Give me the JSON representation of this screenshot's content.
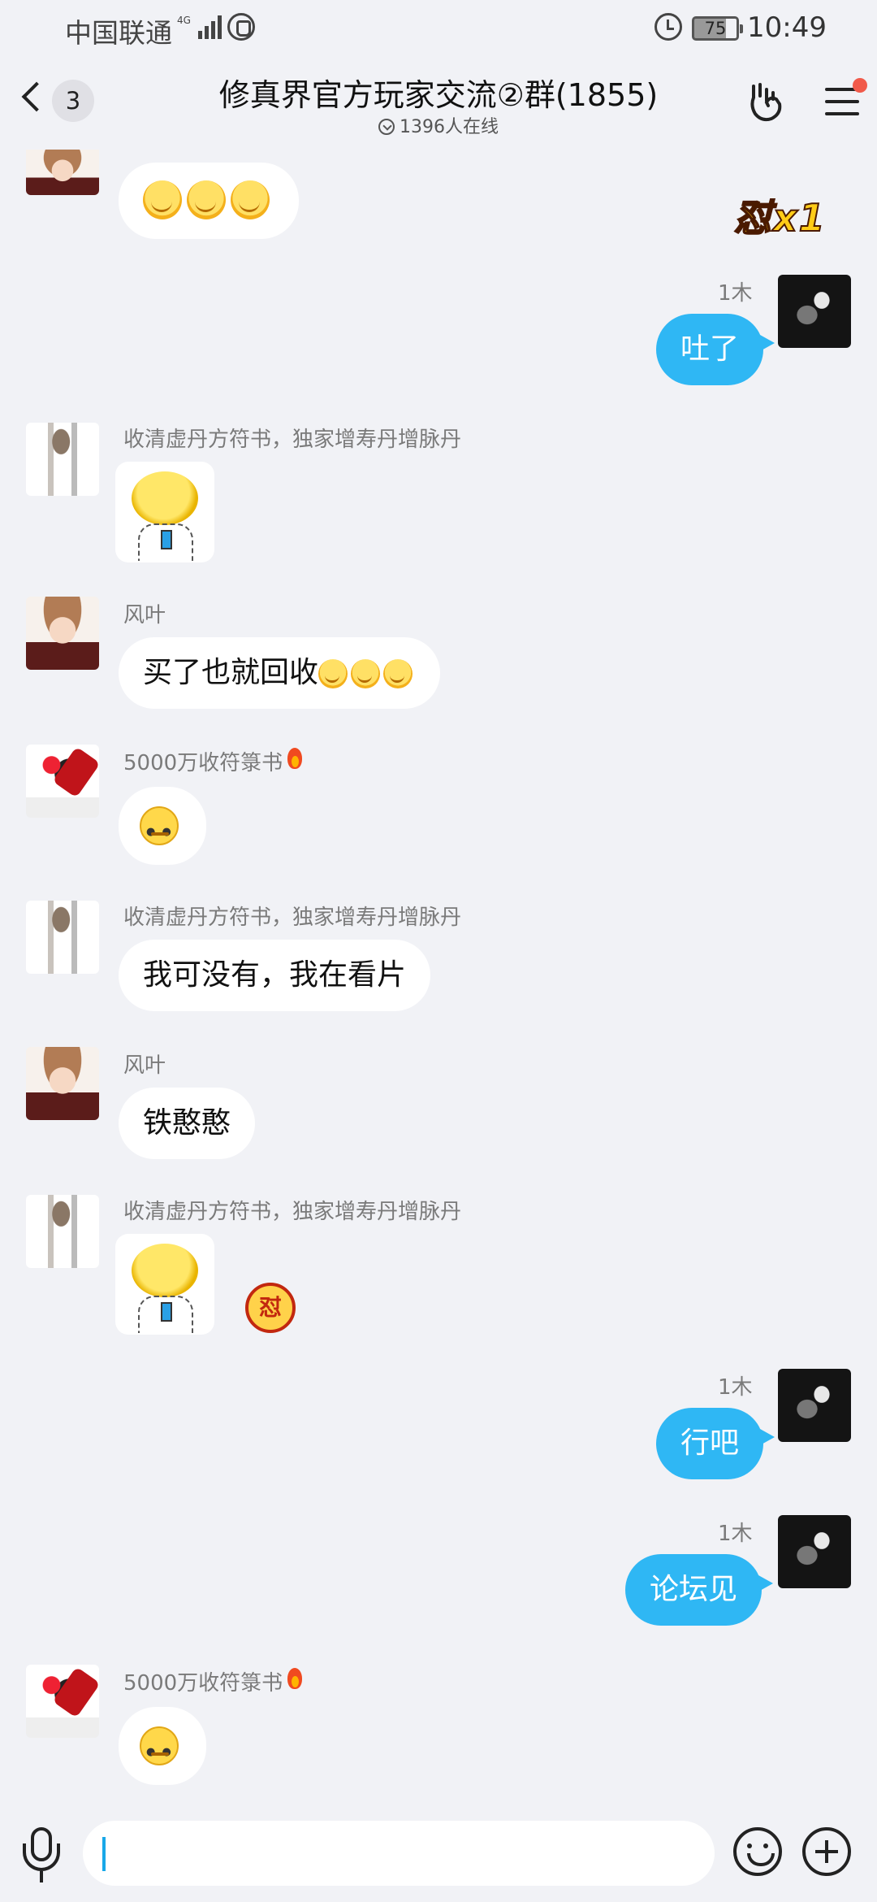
{
  "status_bar": {
    "carrier": "中国联通",
    "network": "4G",
    "battery": "75",
    "time": "10:49"
  },
  "header": {
    "back_count": "3",
    "title": "修真界官方玩家交流②群(1855)",
    "online": "1396人在线"
  },
  "badge_text": "怼x1",
  "duo_badge_text": "怼",
  "messages": [
    {
      "sender": "",
      "type": "emoji",
      "emojis": 3
    },
    {
      "sender": "1木",
      "type": "text",
      "text": "吐了",
      "me": true
    },
    {
      "sender": "收清虚丹方符书，独家增寿丹增脉丹",
      "type": "sticker"
    },
    {
      "sender": "风叶",
      "type": "text",
      "text": "买了也就回收"
    },
    {
      "sender": "5000万收符箓书",
      "type": "emoji"
    },
    {
      "sender": "收清虚丹方符书，独家增寿丹增脉丹",
      "type": "text",
      "text": "我可没有，我在看片"
    },
    {
      "sender": "风叶",
      "type": "text",
      "text": "铁憨憨"
    },
    {
      "sender": "收清虚丹方符书，独家增寿丹增脉丹",
      "type": "sticker"
    },
    {
      "sender": "1木",
      "type": "text",
      "text": "行吧",
      "me": true
    },
    {
      "sender": "1木",
      "type": "text",
      "text": "论坛见",
      "me": true
    },
    {
      "sender": "5000万收符箓书",
      "type": "emoji"
    }
  ],
  "colors": {
    "my_bubble": "#2fb7f4",
    "background": "#f1f2f6",
    "bubble": "#ffffff"
  }
}
